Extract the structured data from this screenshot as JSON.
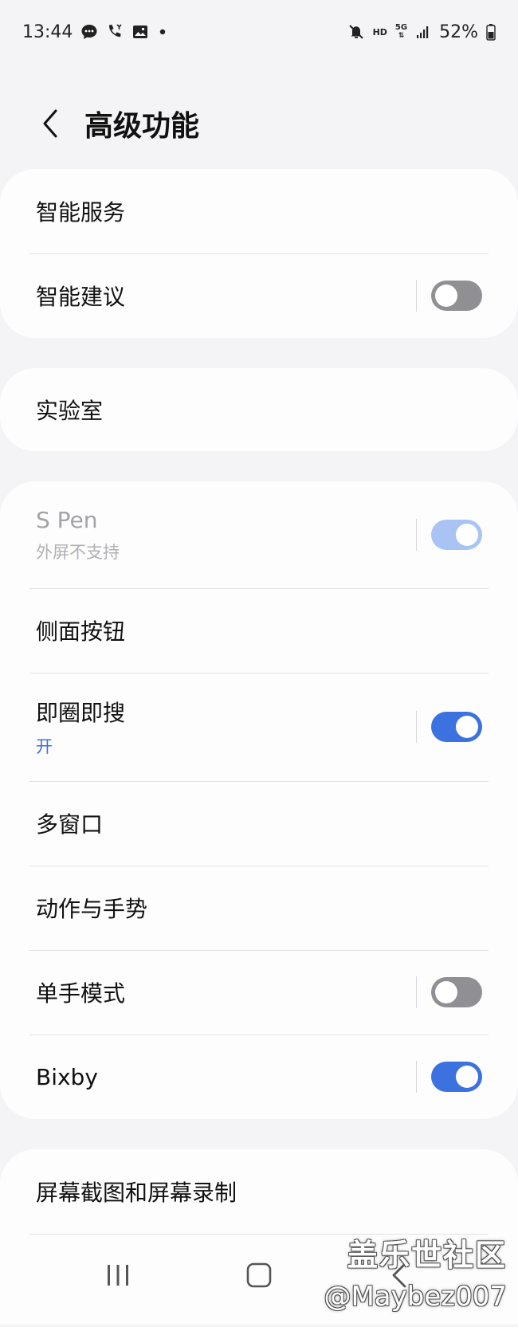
{
  "status_bar": {
    "time": "13:44",
    "hd": "HD",
    "network": "5G",
    "battery": "52%",
    "icons_left": [
      "message-icon",
      "missed-call-icon",
      "gallery-icon",
      "dot-icon"
    ],
    "icons_right": [
      "mute-icon",
      "hd-icon",
      "5g-icon",
      "signal-icon",
      "battery-icon"
    ]
  },
  "header": {
    "title": "高级功能"
  },
  "groups": {
    "g1": {
      "smart_services": "智能服务",
      "smart_suggestions": "智能建议",
      "smart_suggestions_state": "off"
    },
    "g2": {
      "lab": "实验室"
    },
    "g3": {
      "s_pen": "S Pen",
      "s_pen_sub": "外屏不支持",
      "s_pen_state": "on-disabled",
      "side_button": "侧面按钮",
      "circle_search": "即圈即搜",
      "circle_search_sub": "开",
      "circle_search_state": "on",
      "multi_window": "多窗口",
      "motions": "动作与手势",
      "one_hand": "单手模式",
      "one_hand_state": "off",
      "bixby": "Bixby",
      "bixby_state": "on"
    },
    "g4": {
      "screenshots": "屏幕截图和屏幕录制"
    }
  },
  "colors": {
    "background": "#f4f4f6",
    "card": "#fdfdfe",
    "toggle_on": "#3c72e0",
    "toggle_off": "#8f8f94",
    "toggle_on_disabled": "#a9c4f3",
    "sub_blue": "#3e6fd4"
  },
  "nav": {
    "icons": [
      "recents-icon",
      "home-icon",
      "back-nav-icon"
    ]
  },
  "watermark": {
    "line1": "盖乐世社区",
    "line2": "@Maybez007"
  }
}
